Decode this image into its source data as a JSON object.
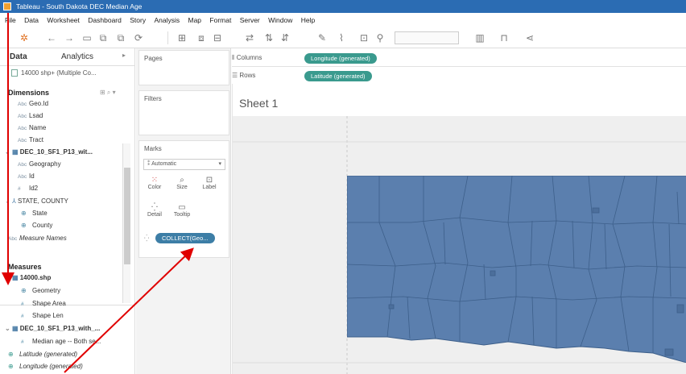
{
  "window": {
    "title": "Tableau - South Dakota DEC Median Age"
  },
  "menu": [
    "File",
    "Data",
    "Worksheet",
    "Dashboard",
    "Story",
    "Analysis",
    "Map",
    "Format",
    "Server",
    "Window",
    "Help"
  ],
  "leftpane": {
    "tabs": {
      "data": "Data",
      "analytics": "Analytics"
    },
    "datasource": "14000 shp+ (Multiple Co...",
    "dimensions_header": "Dimensions",
    "dimensions": [
      {
        "type": "Abc",
        "label": "Geo.Id"
      },
      {
        "type": "Abc",
        "label": "Lsad"
      },
      {
        "type": "Abc",
        "label": "Name"
      },
      {
        "type": "Abc",
        "label": "Tract"
      }
    ],
    "table1": "DEC_10_SF1_P13_wit...",
    "table1_fields": [
      {
        "type": "Abc",
        "label": "Geography"
      },
      {
        "type": "Abc",
        "label": "Id"
      },
      {
        "type": "#",
        "label": "Id2"
      }
    ],
    "hier": "STATE, COUNTY",
    "hier_fields": [
      {
        "type": "geo",
        "label": "State"
      },
      {
        "type": "geo",
        "label": "County"
      }
    ],
    "measure_names": "Measure Names",
    "measures_header": "Measures",
    "shp_table": "14000.shp",
    "shp_fields": [
      {
        "type": "geo",
        "label": "Geometry"
      },
      {
        "type": "#",
        "label": "Shape Area"
      },
      {
        "type": "#",
        "label": "Shape Len"
      }
    ],
    "table2": "DEC_10_SF1_P13_with_...",
    "table2_fields": [
      {
        "type": "#",
        "label": "Median age -- Both se..."
      }
    ],
    "latitude": "Latitude (generated)",
    "longitude": "Longitude (generated)"
  },
  "cards": {
    "pages": "Pages",
    "filters": "Filters",
    "marks": "Marks",
    "mark_type": "Automatic",
    "buttons": {
      "color": "Color",
      "size": "Size",
      "label": "Label",
      "detail": "Detail",
      "tooltip": "Tooltip"
    },
    "collect_pill": "COLLECT(Geo..."
  },
  "shelves": {
    "columns_label": "Columns",
    "columns_pill": "Longitude (generated)",
    "rows_label": "Rows",
    "rows_pill": "Latitude (generated)"
  },
  "sheet": {
    "title": "Sheet 1"
  },
  "colors": {
    "map_fill": "#5b7fae",
    "map_border": "#3d5f8a",
    "pill": "#3a9a8e",
    "arrow": "#e00000"
  }
}
